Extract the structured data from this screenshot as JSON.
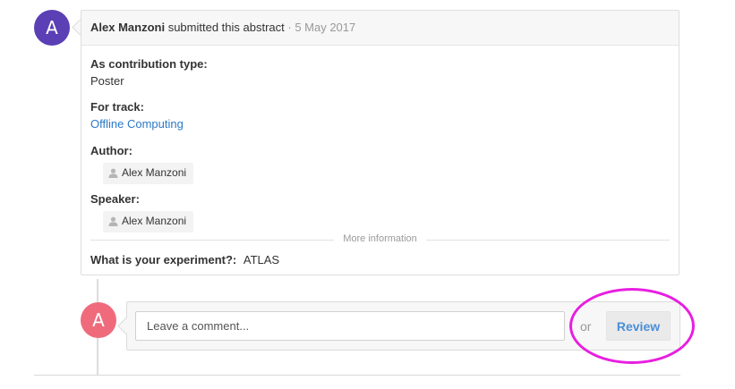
{
  "submitter": {
    "avatar_letter": "A",
    "avatar_color": "#5b3fb5",
    "name": "Alex Manzoni",
    "action": " submitted this abstract",
    "separator": " · ",
    "date": "5 May 2017"
  },
  "abstract": {
    "contribution_type": {
      "label": "As contribution type:",
      "value": "Poster"
    },
    "track": {
      "label": "For track:",
      "value": "Offline Computing"
    },
    "author": {
      "label": "Author:",
      "name": "Alex Manzoni",
      "icon": "person-icon"
    },
    "speaker": {
      "label": "Speaker:",
      "name": "Alex Manzoni",
      "icon": "person-icon"
    },
    "more_information": "More information",
    "experiment": {
      "label": "What is your experiment?:",
      "value": "ATLAS"
    }
  },
  "comment": {
    "avatar_letter": "A",
    "avatar_color": "#ef6b7c",
    "placeholder": "Leave a comment...",
    "or_label": "or",
    "review_label": "Review"
  },
  "colors": {
    "link": "#2c79c7",
    "review_text": "#4a8fd6",
    "highlight": "#e81ee0"
  }
}
